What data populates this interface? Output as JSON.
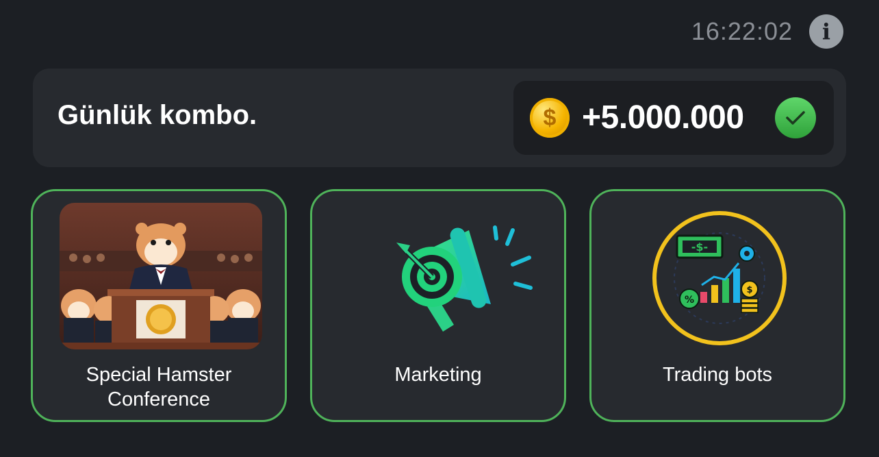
{
  "header": {
    "time": "16:22:02",
    "info_icon": "info-icon"
  },
  "combo": {
    "title": "Günlük kombo.",
    "reward": "+5.000.000",
    "coin_icon": "dollar-coin-icon",
    "check_icon": "check-icon"
  },
  "cards": [
    {
      "label": "Special Hamster\nConference",
      "image": "hamster-conference-image"
    },
    {
      "label": "Marketing",
      "image": "megaphone-target-icon"
    },
    {
      "label": "Trading bots",
      "image": "trading-bots-icon"
    }
  ],
  "colors": {
    "background": "#1c1f24",
    "panel": "#272a2f",
    "card_border": "#4fb35a",
    "check_green": "#3cb849",
    "coin_gold": "#f5b400"
  }
}
